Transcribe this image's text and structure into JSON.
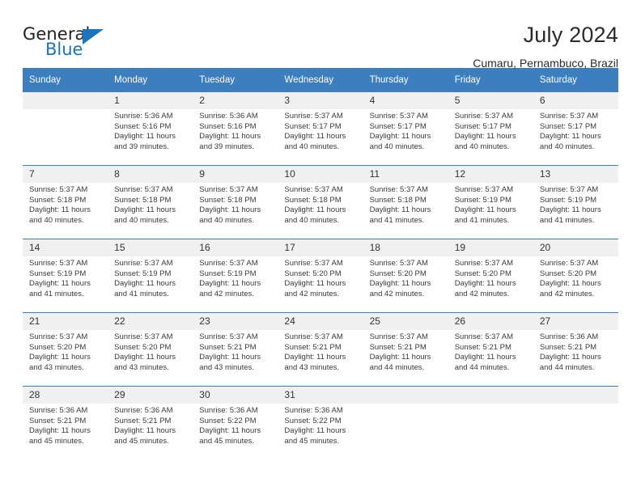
{
  "brand": {
    "name_part1": "General",
    "name_part2": "Blue",
    "accent_color": "#1b74bc",
    "triangle_icon": "brand-triangle-icon"
  },
  "header": {
    "month_title": "July 2024",
    "location": "Cumaru, Pernambuco, Brazil"
  },
  "calendar": {
    "header_color": "#3d7ebf",
    "daynum_background": "#f0f0f0",
    "weekday_headers": [
      "Sunday",
      "Monday",
      "Tuesday",
      "Wednesday",
      "Thursday",
      "Friday",
      "Saturday"
    ],
    "weeks": [
      [
        {
          "day": "",
          "empty": true,
          "sunrise": "",
          "sunset": "",
          "daylight_1": "",
          "daylight_2": ""
        },
        {
          "day": "1",
          "sunrise": "Sunrise: 5:36 AM",
          "sunset": "Sunset: 5:16 PM",
          "daylight_1": "Daylight: 11 hours",
          "daylight_2": "and 39 minutes."
        },
        {
          "day": "2",
          "sunrise": "Sunrise: 5:36 AM",
          "sunset": "Sunset: 5:16 PM",
          "daylight_1": "Daylight: 11 hours",
          "daylight_2": "and 39 minutes."
        },
        {
          "day": "3",
          "sunrise": "Sunrise: 5:37 AM",
          "sunset": "Sunset: 5:17 PM",
          "daylight_1": "Daylight: 11 hours",
          "daylight_2": "and 40 minutes."
        },
        {
          "day": "4",
          "sunrise": "Sunrise: 5:37 AM",
          "sunset": "Sunset: 5:17 PM",
          "daylight_1": "Daylight: 11 hours",
          "daylight_2": "and 40 minutes."
        },
        {
          "day": "5",
          "sunrise": "Sunrise: 5:37 AM",
          "sunset": "Sunset: 5:17 PM",
          "daylight_1": "Daylight: 11 hours",
          "daylight_2": "and 40 minutes."
        },
        {
          "day": "6",
          "sunrise": "Sunrise: 5:37 AM",
          "sunset": "Sunset: 5:17 PM",
          "daylight_1": "Daylight: 11 hours",
          "daylight_2": "and 40 minutes."
        }
      ],
      [
        {
          "day": "7",
          "sunrise": "Sunrise: 5:37 AM",
          "sunset": "Sunset: 5:18 PM",
          "daylight_1": "Daylight: 11 hours",
          "daylight_2": "and 40 minutes."
        },
        {
          "day": "8",
          "sunrise": "Sunrise: 5:37 AM",
          "sunset": "Sunset: 5:18 PM",
          "daylight_1": "Daylight: 11 hours",
          "daylight_2": "and 40 minutes."
        },
        {
          "day": "9",
          "sunrise": "Sunrise: 5:37 AM",
          "sunset": "Sunset: 5:18 PM",
          "daylight_1": "Daylight: 11 hours",
          "daylight_2": "and 40 minutes."
        },
        {
          "day": "10",
          "sunrise": "Sunrise: 5:37 AM",
          "sunset": "Sunset: 5:18 PM",
          "daylight_1": "Daylight: 11 hours",
          "daylight_2": "and 40 minutes."
        },
        {
          "day": "11",
          "sunrise": "Sunrise: 5:37 AM",
          "sunset": "Sunset: 5:18 PM",
          "daylight_1": "Daylight: 11 hours",
          "daylight_2": "and 41 minutes."
        },
        {
          "day": "12",
          "sunrise": "Sunrise: 5:37 AM",
          "sunset": "Sunset: 5:19 PM",
          "daylight_1": "Daylight: 11 hours",
          "daylight_2": "and 41 minutes."
        },
        {
          "day": "13",
          "sunrise": "Sunrise: 5:37 AM",
          "sunset": "Sunset: 5:19 PM",
          "daylight_1": "Daylight: 11 hours",
          "daylight_2": "and 41 minutes."
        }
      ],
      [
        {
          "day": "14",
          "sunrise": "Sunrise: 5:37 AM",
          "sunset": "Sunset: 5:19 PM",
          "daylight_1": "Daylight: 11 hours",
          "daylight_2": "and 41 minutes."
        },
        {
          "day": "15",
          "sunrise": "Sunrise: 5:37 AM",
          "sunset": "Sunset: 5:19 PM",
          "daylight_1": "Daylight: 11 hours",
          "daylight_2": "and 41 minutes."
        },
        {
          "day": "16",
          "sunrise": "Sunrise: 5:37 AM",
          "sunset": "Sunset: 5:19 PM",
          "daylight_1": "Daylight: 11 hours",
          "daylight_2": "and 42 minutes."
        },
        {
          "day": "17",
          "sunrise": "Sunrise: 5:37 AM",
          "sunset": "Sunset: 5:20 PM",
          "daylight_1": "Daylight: 11 hours",
          "daylight_2": "and 42 minutes."
        },
        {
          "day": "18",
          "sunrise": "Sunrise: 5:37 AM",
          "sunset": "Sunset: 5:20 PM",
          "daylight_1": "Daylight: 11 hours",
          "daylight_2": "and 42 minutes."
        },
        {
          "day": "19",
          "sunrise": "Sunrise: 5:37 AM",
          "sunset": "Sunset: 5:20 PM",
          "daylight_1": "Daylight: 11 hours",
          "daylight_2": "and 42 minutes."
        },
        {
          "day": "20",
          "sunrise": "Sunrise: 5:37 AM",
          "sunset": "Sunset: 5:20 PM",
          "daylight_1": "Daylight: 11 hours",
          "daylight_2": "and 42 minutes."
        }
      ],
      [
        {
          "day": "21",
          "sunrise": "Sunrise: 5:37 AM",
          "sunset": "Sunset: 5:20 PM",
          "daylight_1": "Daylight: 11 hours",
          "daylight_2": "and 43 minutes."
        },
        {
          "day": "22",
          "sunrise": "Sunrise: 5:37 AM",
          "sunset": "Sunset: 5:20 PM",
          "daylight_1": "Daylight: 11 hours",
          "daylight_2": "and 43 minutes."
        },
        {
          "day": "23",
          "sunrise": "Sunrise: 5:37 AM",
          "sunset": "Sunset: 5:21 PM",
          "daylight_1": "Daylight: 11 hours",
          "daylight_2": "and 43 minutes."
        },
        {
          "day": "24",
          "sunrise": "Sunrise: 5:37 AM",
          "sunset": "Sunset: 5:21 PM",
          "daylight_1": "Daylight: 11 hours",
          "daylight_2": "and 43 minutes."
        },
        {
          "day": "25",
          "sunrise": "Sunrise: 5:37 AM",
          "sunset": "Sunset: 5:21 PM",
          "daylight_1": "Daylight: 11 hours",
          "daylight_2": "and 44 minutes."
        },
        {
          "day": "26",
          "sunrise": "Sunrise: 5:37 AM",
          "sunset": "Sunset: 5:21 PM",
          "daylight_1": "Daylight: 11 hours",
          "daylight_2": "and 44 minutes."
        },
        {
          "day": "27",
          "sunrise": "Sunrise: 5:36 AM",
          "sunset": "Sunset: 5:21 PM",
          "daylight_1": "Daylight: 11 hours",
          "daylight_2": "and 44 minutes."
        }
      ],
      [
        {
          "day": "28",
          "sunrise": "Sunrise: 5:36 AM",
          "sunset": "Sunset: 5:21 PM",
          "daylight_1": "Daylight: 11 hours",
          "daylight_2": "and 45 minutes."
        },
        {
          "day": "29",
          "sunrise": "Sunrise: 5:36 AM",
          "sunset": "Sunset: 5:21 PM",
          "daylight_1": "Daylight: 11 hours",
          "daylight_2": "and 45 minutes."
        },
        {
          "day": "30",
          "sunrise": "Sunrise: 5:36 AM",
          "sunset": "Sunset: 5:22 PM",
          "daylight_1": "Daylight: 11 hours",
          "daylight_2": "and 45 minutes."
        },
        {
          "day": "31",
          "sunrise": "Sunrise: 5:36 AM",
          "sunset": "Sunset: 5:22 PM",
          "daylight_1": "Daylight: 11 hours",
          "daylight_2": "and 45 minutes."
        },
        {
          "day": "",
          "empty": true,
          "sunrise": "",
          "sunset": "",
          "daylight_1": "",
          "daylight_2": ""
        },
        {
          "day": "",
          "empty": true,
          "sunrise": "",
          "sunset": "",
          "daylight_1": "",
          "daylight_2": ""
        },
        {
          "day": "",
          "empty": true,
          "sunrise": "",
          "sunset": "",
          "daylight_1": "",
          "daylight_2": ""
        }
      ]
    ]
  }
}
